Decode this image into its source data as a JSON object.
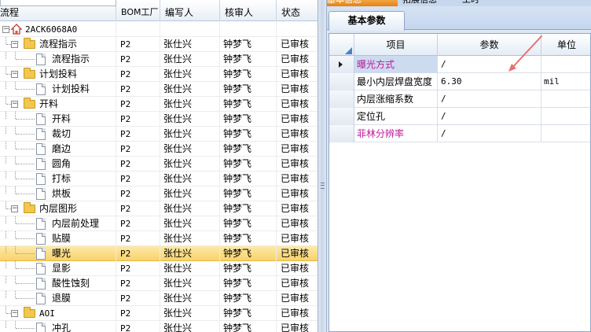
{
  "left": {
    "columns": [
      "流程",
      "BOM工厂",
      "编写人",
      "核审人",
      "状态"
    ],
    "root_label": "2ACK6068A0",
    "rows": [
      {
        "label": "流程指示",
        "kind": "folder",
        "level": 1,
        "bom": "P2",
        "author": "张仕兴",
        "reviewer": "钟梦飞",
        "status": "已审核"
      },
      {
        "label": "流程指示",
        "kind": "doc",
        "level": 2,
        "bom": "P2",
        "author": "张仕兴",
        "reviewer": "钟梦飞",
        "status": "已审核"
      },
      {
        "label": "计划投料",
        "kind": "folder",
        "level": 1,
        "bom": "P2",
        "author": "张仕兴",
        "reviewer": "钟梦飞",
        "status": "已审核"
      },
      {
        "label": "计划投料",
        "kind": "doc",
        "level": 2,
        "bom": "P2",
        "author": "张仕兴",
        "reviewer": "钟梦飞",
        "status": "已审核"
      },
      {
        "label": "开料",
        "kind": "folder",
        "level": 1,
        "bom": "P2",
        "author": "张仕兴",
        "reviewer": "钟梦飞",
        "status": "已审核"
      },
      {
        "label": "开料",
        "kind": "doc",
        "level": 2,
        "bom": "P2",
        "author": "张仕兴",
        "reviewer": "钟梦飞",
        "status": "已审核"
      },
      {
        "label": "裁切",
        "kind": "doc",
        "level": 2,
        "bom": "P2",
        "author": "张仕兴",
        "reviewer": "钟梦飞",
        "status": "已审核"
      },
      {
        "label": "磨边",
        "kind": "doc",
        "level": 2,
        "bom": "P2",
        "author": "张仕兴",
        "reviewer": "钟梦飞",
        "status": "已审核"
      },
      {
        "label": "圆角",
        "kind": "doc",
        "level": 2,
        "bom": "P2",
        "author": "张仕兴",
        "reviewer": "钟梦飞",
        "status": "已审核"
      },
      {
        "label": "打标",
        "kind": "doc",
        "level": 2,
        "bom": "P2",
        "author": "张仕兴",
        "reviewer": "钟梦飞",
        "status": "已审核"
      },
      {
        "label": "烘板",
        "kind": "doc",
        "level": 2,
        "bom": "P2",
        "author": "张仕兴",
        "reviewer": "钟梦飞",
        "status": "已审核"
      },
      {
        "label": "内层图形",
        "kind": "folder",
        "level": 1,
        "bom": "P2",
        "author": "张仕兴",
        "reviewer": "钟梦飞",
        "status": "已审核"
      },
      {
        "label": "内层前处理",
        "kind": "doc",
        "level": 2,
        "bom": "P2",
        "author": "张仕兴",
        "reviewer": "钟梦飞",
        "status": "已审核"
      },
      {
        "label": "贴膜",
        "kind": "doc",
        "level": 2,
        "bom": "P2",
        "author": "张仕兴",
        "reviewer": "钟梦飞",
        "status": "已审核"
      },
      {
        "label": "曝光",
        "kind": "doc",
        "level": 2,
        "bom": "P2",
        "author": "张仕兴",
        "reviewer": "钟梦飞",
        "status": "已审核",
        "selected": true
      },
      {
        "label": "显影",
        "kind": "doc",
        "level": 2,
        "bom": "P2",
        "author": "张仕兴",
        "reviewer": "钟梦飞",
        "status": "已审核"
      },
      {
        "label": "酸性蚀刻",
        "kind": "doc",
        "level": 2,
        "bom": "P2",
        "author": "张仕兴",
        "reviewer": "钟梦飞",
        "status": "已审核"
      },
      {
        "label": "退膜",
        "kind": "doc",
        "level": 2,
        "bom": "P2",
        "author": "张仕兴",
        "reviewer": "钟梦飞",
        "status": "已审核"
      },
      {
        "label": "AOI",
        "kind": "folder",
        "level": 1,
        "bom": "P2",
        "author": "张仕兴",
        "reviewer": "钟梦飞",
        "status": "已审核"
      },
      {
        "label": "冲孔",
        "kind": "doc",
        "level": 2,
        "bom": "P2",
        "author": "张仕兴",
        "reviewer": "钟梦飞",
        "status": "已审核"
      }
    ]
  },
  "right": {
    "top_tabs": [
      "基本信息",
      "拓展信息",
      "工时"
    ],
    "sub_tab": "基本参数",
    "grid_columns": [
      "项目",
      "参数",
      "单位"
    ],
    "grid_rows": [
      {
        "item": "曝光方式",
        "param": "/",
        "unit": "",
        "current": true,
        "style": "pink"
      },
      {
        "item": "最小内层焊盘宽度",
        "param": "6.30",
        "unit": "mil",
        "style": "normal"
      },
      {
        "item": "内层涨缩系数",
        "param": "/",
        "unit": "",
        "style": "normal"
      },
      {
        "item": "定位孔",
        "param": "/",
        "unit": "",
        "style": "normal"
      },
      {
        "item": "菲林分辨率",
        "param": "/",
        "unit": "",
        "style": "pink"
      }
    ]
  },
  "colors": {
    "selection": "#f8d36a",
    "accent_tab": "#e77f12",
    "pink_text": "#c0189a",
    "annotation_arrow": "#e8706a"
  },
  "icons": [
    "folder-icon",
    "document-icon",
    "home-icon",
    "row-pointer-icon",
    "splitter-grip-icon"
  ]
}
